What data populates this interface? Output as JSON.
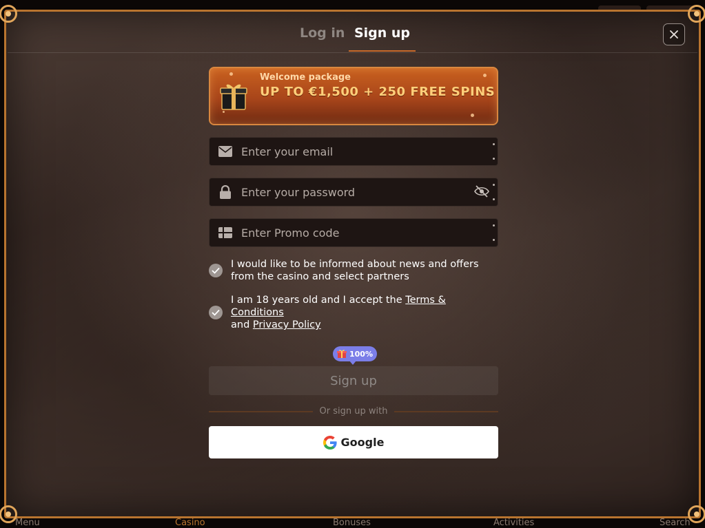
{
  "background": {
    "nav": [
      "Menu",
      "Casino",
      "Bonuses",
      "Activities",
      "Search"
    ]
  },
  "modal": {
    "tabs": [
      {
        "label": "Log in",
        "active": false
      },
      {
        "label": "Sign up",
        "active": true
      }
    ],
    "close_icon": "close-icon",
    "promo": {
      "label": "Welcome package",
      "offer": "Up to €1,500 + 250 Free spins",
      "icon": "gift-icon"
    },
    "fields": {
      "email_placeholder": "Enter your email",
      "password_placeholder": "Enter your password",
      "promo_placeholder": "Enter Promo code"
    },
    "consents": {
      "news": "I would like to be informed about news and offers from the casino and select partners",
      "age_prefix": "I am 18 years old and I accept the ",
      "terms_link": "Terms & Conditions",
      "and": "and ",
      "privacy_link": "Privacy Policy"
    },
    "badge": "100%",
    "submit_label": "Sign up",
    "social_divider": "Or sign up with",
    "google_label": "Google"
  },
  "colors": {
    "accent": "#c86a2b",
    "promo_gold": "#ffcf7a",
    "badge": "#7b7ee8"
  }
}
